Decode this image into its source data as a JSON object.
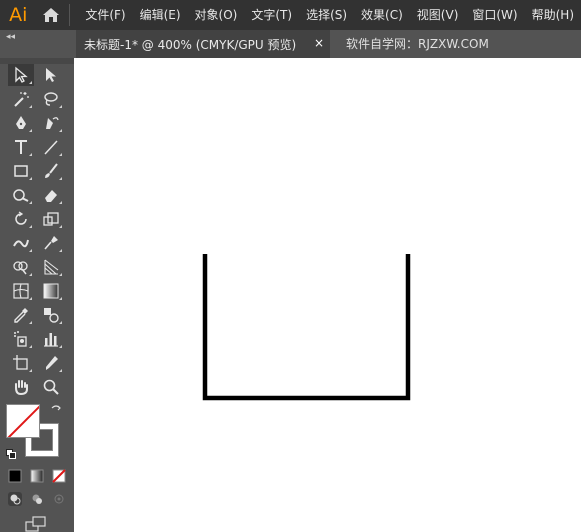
{
  "app": {
    "logo_text": "Ai",
    "accent": "#ff9a00"
  },
  "menu": {
    "items": [
      "文件(F)",
      "编辑(E)",
      "对象(O)",
      "文字(T)",
      "选择(S)",
      "效果(C)",
      "视图(V)",
      "窗口(W)",
      "帮助(H)"
    ]
  },
  "tabs": {
    "collapse_label": "◂◂",
    "active": {
      "title": "未标题-1* @ 400% (CMYK/GPU 预览)",
      "close": "×"
    },
    "inactive": {
      "title": "软件自学网：RJZXW.COM"
    }
  },
  "toolbar": {
    "icons": [
      "selection-tool-icon",
      "direct-selection-tool-icon",
      "magic-wand-tool-icon",
      "lasso-tool-icon",
      "pen-tool-icon",
      "curvature-tool-icon",
      "type-tool-icon",
      "line-segment-tool-icon",
      "rectangle-tool-icon",
      "paintbrush-tool-icon",
      "shaper-tool-icon",
      "eraser-tool-icon",
      "rotate-tool-icon",
      "scale-tool-icon",
      "width-tool-icon",
      "puppet-warp-tool-icon",
      "shape-builder-tool-icon",
      "perspective-grid-tool-icon",
      "mesh-tool-icon",
      "gradient-tool-icon",
      "eyedropper-tool-icon",
      "blend-tool-icon",
      "symbol-sprayer-tool-icon",
      "column-graph-tool-icon",
      "artboard-tool-icon",
      "slice-tool-icon",
      "hand-tool-icon",
      "zoom-tool-icon"
    ],
    "fill": "none",
    "stroke": "black"
  },
  "canvas": {
    "background": "#ffffff",
    "stroke_color": "#000000"
  }
}
